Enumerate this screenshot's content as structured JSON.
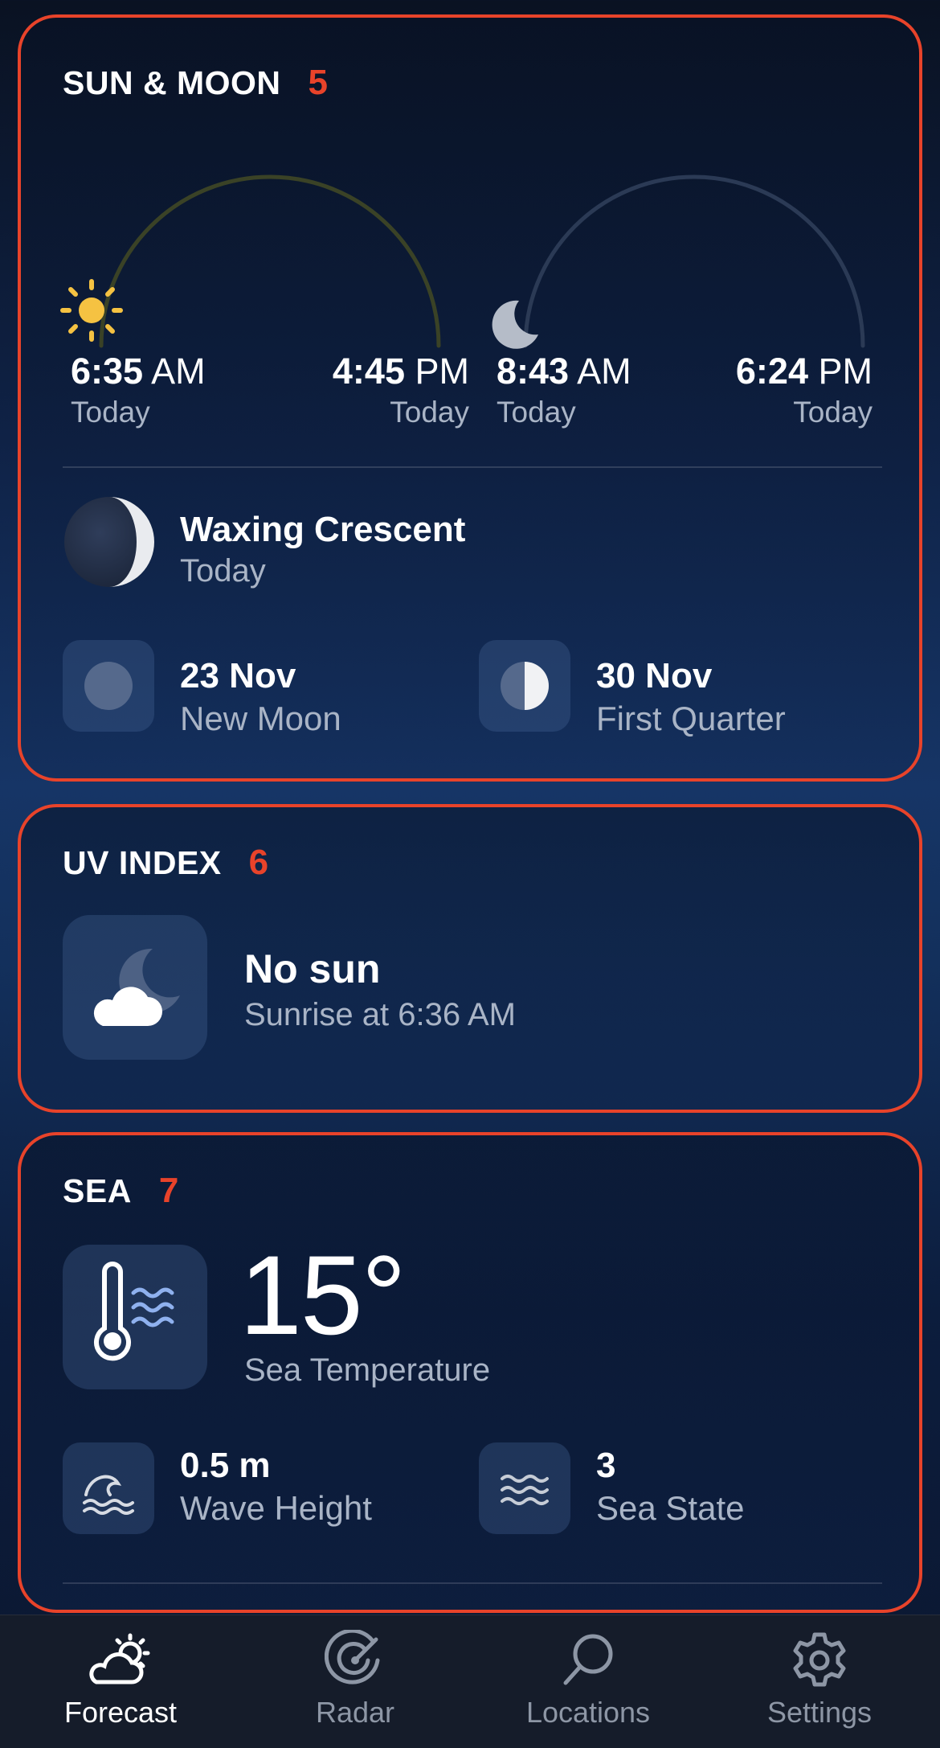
{
  "sun_moon": {
    "title": "SUN & MOON",
    "badge": "5",
    "sun": {
      "rise_time": "6:35",
      "rise_ampm": "AM",
      "rise_day": "Today",
      "set_time": "4:45",
      "set_ampm": "PM",
      "set_day": "Today"
    },
    "moon": {
      "rise_time": "8:43",
      "rise_ampm": "AM",
      "rise_day": "Today",
      "set_time": "6:24",
      "set_ampm": "PM",
      "set_day": "Today"
    },
    "phase": {
      "name": "Waxing Crescent",
      "when": "Today"
    },
    "next_phases": [
      {
        "date": "23 Nov",
        "name": "New Moon"
      },
      {
        "date": "30 Nov",
        "name": "First Quarter"
      }
    ]
  },
  "uv_index": {
    "title": "UV INDEX",
    "badge": "6",
    "status": "No sun",
    "detail": "Sunrise at 6:36 AM"
  },
  "sea": {
    "title": "SEA",
    "badge": "7",
    "temperature": "15°",
    "temperature_label": "Sea Temperature",
    "stats": [
      {
        "value": "0.5 m",
        "label": "Wave Height"
      },
      {
        "value": "3",
        "label": "Sea State"
      }
    ]
  },
  "tabbar": {
    "tabs": [
      {
        "label": "Forecast",
        "icon": "weather-icon",
        "active": true
      },
      {
        "label": "Radar",
        "icon": "radar-icon",
        "active": false
      },
      {
        "label": "Locations",
        "icon": "search-icon",
        "active": false
      },
      {
        "label": "Settings",
        "icon": "gear-icon",
        "active": false
      }
    ]
  },
  "colors": {
    "accent": "#e8432a",
    "sun": "#f5c242",
    "secondary_text": "#a9b4c6",
    "tabbar_bg": "#151c2a"
  }
}
